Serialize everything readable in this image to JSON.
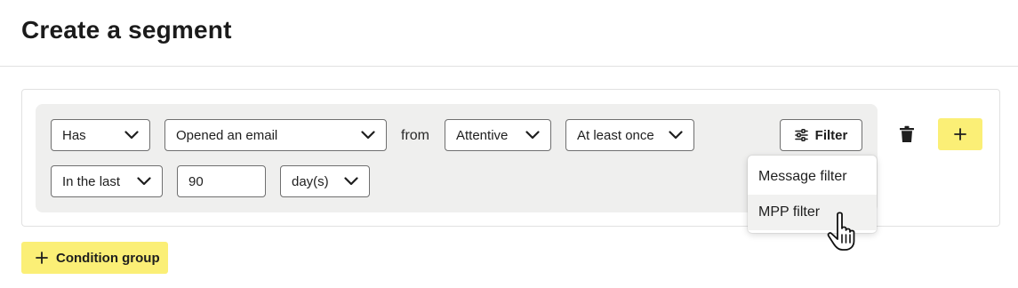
{
  "page": {
    "title": "Create a segment"
  },
  "condition": {
    "has_select": "Has",
    "event_select": "Opened an email",
    "from_label": "from",
    "source_select": "Attentive",
    "frequency_select": "At least once",
    "timeframe_select": "In the last",
    "timeframe_value": "90",
    "unit_select": "day(s)"
  },
  "filter": {
    "button_label": "Filter",
    "menu_items": [
      "Message filter",
      "MPP filter"
    ],
    "hovered_item": "MPP filter"
  },
  "actions": {
    "add_condition_group_label": "Condition group"
  },
  "colors": {
    "accent_yellow": "#fbef76",
    "group_background": "#efefee",
    "border": "#6f6f6f"
  },
  "icons": [
    "chevron-down-icon",
    "sliders-icon",
    "trash-icon",
    "plus-icon",
    "hand-pointer-cursor"
  ]
}
